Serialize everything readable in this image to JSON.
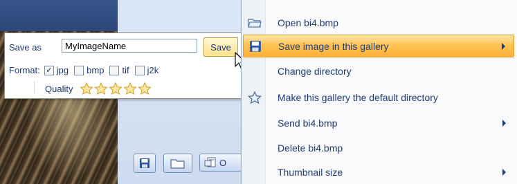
{
  "save_popup": {
    "save_as_label": "Save as",
    "filename_value": "MyImageName",
    "save_button_label": "Save",
    "format_label": "Format:",
    "formats": [
      {
        "label": "jpg",
        "checked": true
      },
      {
        "label": "bmp",
        "checked": false
      },
      {
        "label": "tif",
        "checked": false
      },
      {
        "label": "j2k",
        "checked": false
      }
    ],
    "quality_label": "Quality",
    "quality_stars": 5
  },
  "toolbar": {
    "properties_partial_label": "O",
    "icons": [
      "save-icon",
      "folder-icon",
      "properties-icon"
    ]
  },
  "context_menu": {
    "items": [
      {
        "label": "Open bi4.bmp",
        "icon": "folder-open-icon",
        "submenu": false,
        "highlighted": false
      },
      {
        "label": "Save image in this gallery",
        "icon": "save-icon",
        "submenu": true,
        "highlighted": true
      },
      {
        "label": "Change directory",
        "icon": "",
        "submenu": false,
        "highlighted": false
      },
      {
        "label": "Make this gallery the default directory",
        "icon": "star-icon",
        "submenu": false,
        "highlighted": false
      },
      {
        "label": "Send bi4.bmp",
        "icon": "",
        "submenu": true,
        "highlighted": false
      },
      {
        "label": "Delete bi4.bmp",
        "icon": "",
        "submenu": false,
        "highlighted": false
      },
      {
        "label": "Thumbnail size",
        "icon": "",
        "submenu": true,
        "highlighted": false
      }
    ]
  },
  "colors": {
    "menu_text": "#1e3a78",
    "highlight_orange": "#ffb03a",
    "gallery_blue": "#cfdcef"
  }
}
